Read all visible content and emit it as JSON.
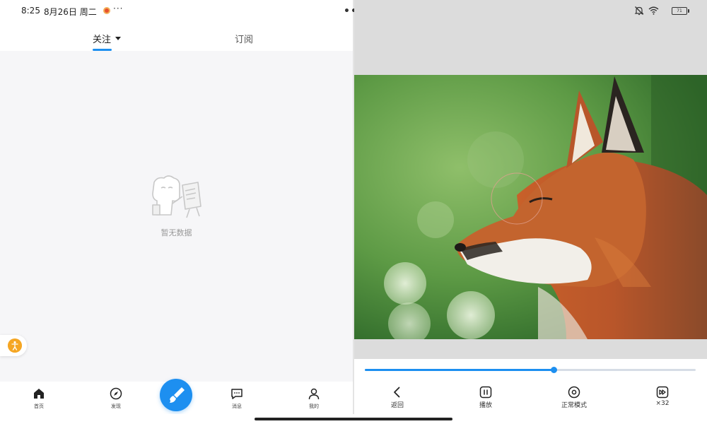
{
  "status_bar": {
    "time": "8:25",
    "date": "8月26日 周二",
    "more": "···",
    "battery": "71"
  },
  "split_handle": "•••",
  "left_app": {
    "tabs": [
      {
        "label": "关注",
        "active": true,
        "has_dropdown": true
      },
      {
        "label": "订阅",
        "active": false
      }
    ],
    "empty_state_text": "暂无数据",
    "bottom_nav": [
      {
        "label": "首页",
        "icon": "home-icon"
      },
      {
        "label": "发现",
        "icon": "compass-icon"
      },
      {
        "label": "",
        "icon": "brush-icon"
      },
      {
        "label": "消息",
        "icon": "message-icon"
      },
      {
        "label": "我的",
        "icon": "user-icon"
      }
    ],
    "accent_color": "#1d8ff0"
  },
  "viewer": {
    "image_subject": "fox-photo",
    "progress_fraction": 0.57,
    "controls": [
      {
        "label": "返回",
        "icon": "back-arrow-icon"
      },
      {
        "label": "播放",
        "icon": "pause-icon"
      },
      {
        "label": "正常模式",
        "icon": "mode-icon"
      },
      {
        "label": "×32",
        "icon": "fast-forward-icon"
      }
    ]
  }
}
